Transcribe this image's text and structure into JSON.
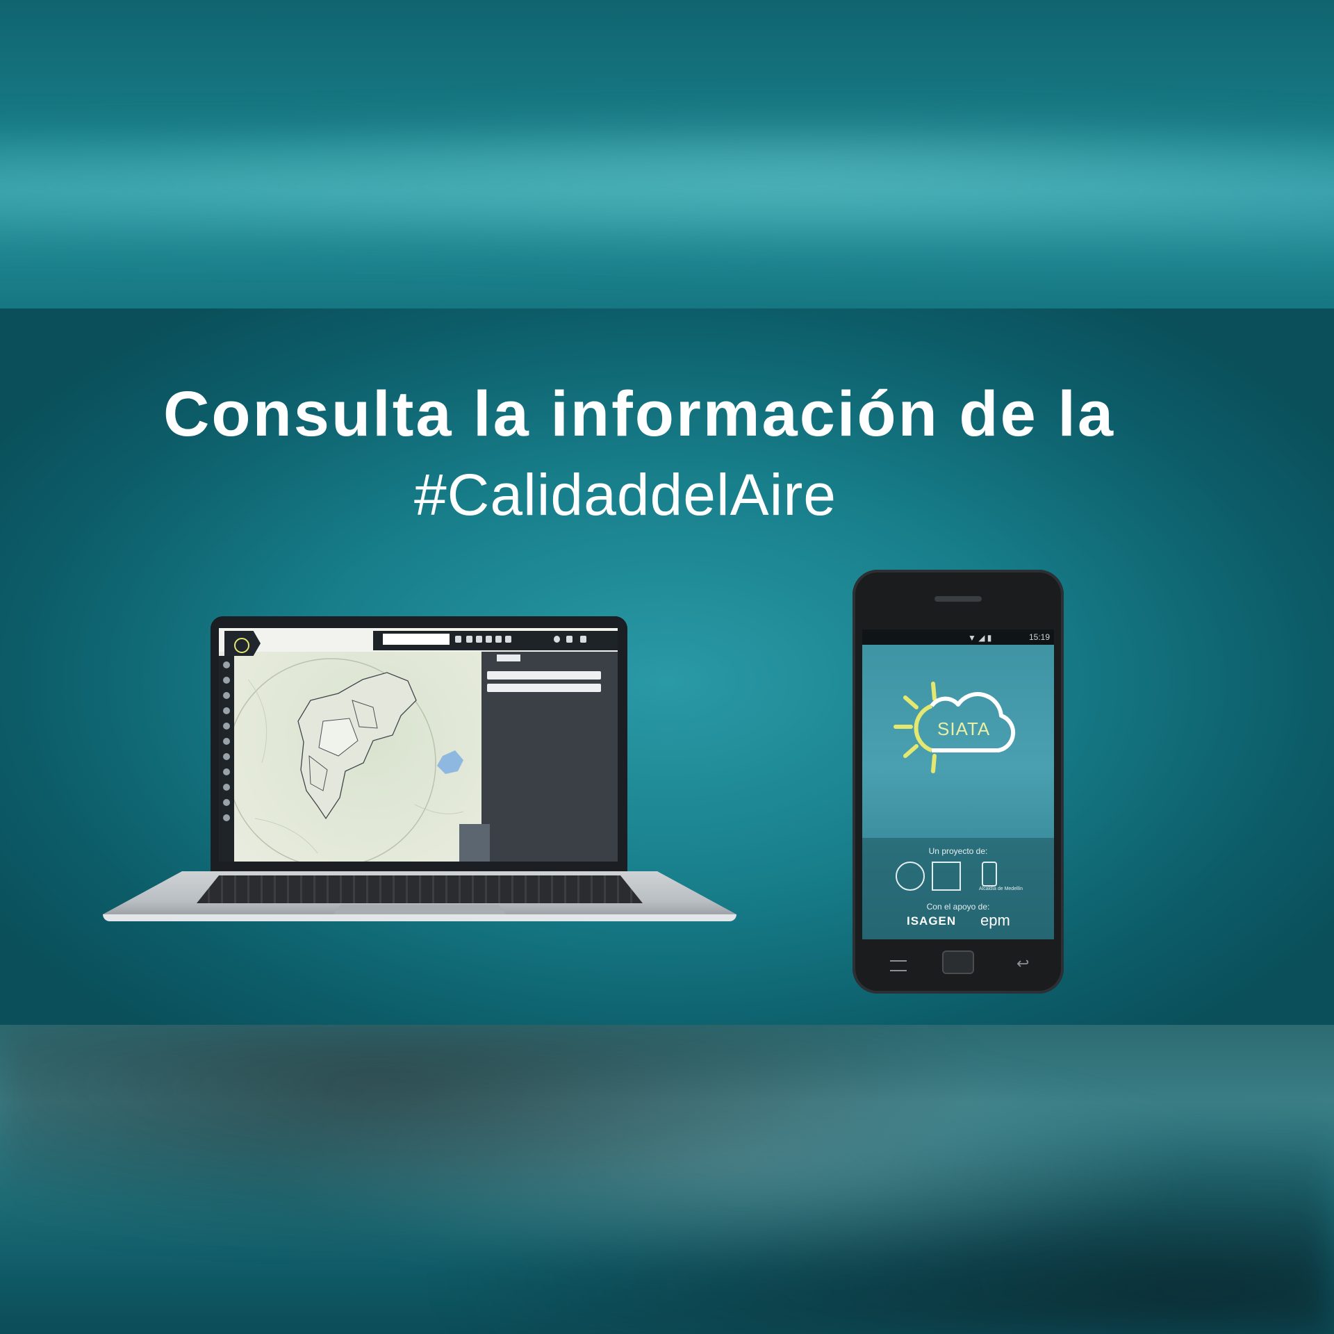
{
  "title": {
    "line1": "Consulta la información de la",
    "line2": "#CalidaddelAire"
  },
  "phone": {
    "status_time": "15:19",
    "app_name": "SIATA",
    "footer": {
      "proyecto_label": "Un proyecto de:",
      "alcaldia_label": "Alcaldía de Medellín",
      "apoyo_label": "Con el apoyo de:",
      "sponsor1": "ISAGEN",
      "sponsor2": "epm"
    }
  },
  "colors": {
    "background": "#177e8a",
    "text": "#ffffff",
    "logo_sun": "#e5e870"
  },
  "icons": [
    "siata-sun-cloud-icon",
    "wifi-icon",
    "signal-icon",
    "battery-icon",
    "menu-icon",
    "home-button-icon",
    "back-icon",
    "search-icon"
  ]
}
